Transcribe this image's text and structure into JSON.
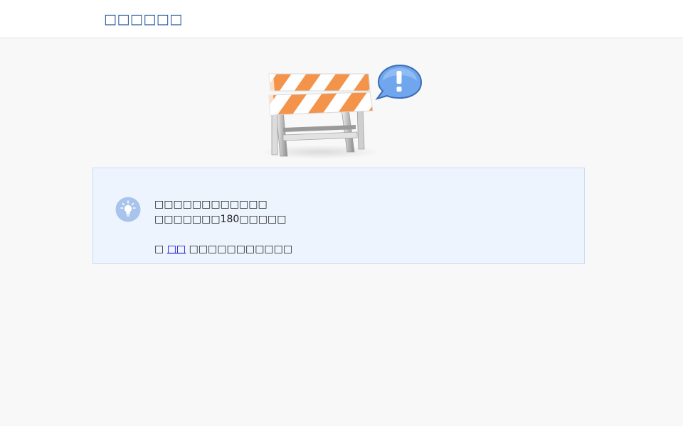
{
  "header": {
    "site_title": "□□□□□□"
  },
  "notice": {
    "icon": "lightbulb-icon",
    "line1": "□□□□□□□□□□□□",
    "line2": "□□□□□□□180□□□□□",
    "line3_prefix": "□ ",
    "line3_link": "□□",
    "line3_suffix": " □□□□□□□□□□□"
  },
  "illustration": {
    "barrier_icon": "road-barrier-icon",
    "bubble_icon": "exclamation-bubble-icon"
  },
  "colors": {
    "title": "#2a5a9e",
    "notice_bg": "#eef4fe",
    "notice_border": "#c9dbf3",
    "stripe_orange": "#f4944a",
    "bubble_blue": "#6fa6ee"
  }
}
